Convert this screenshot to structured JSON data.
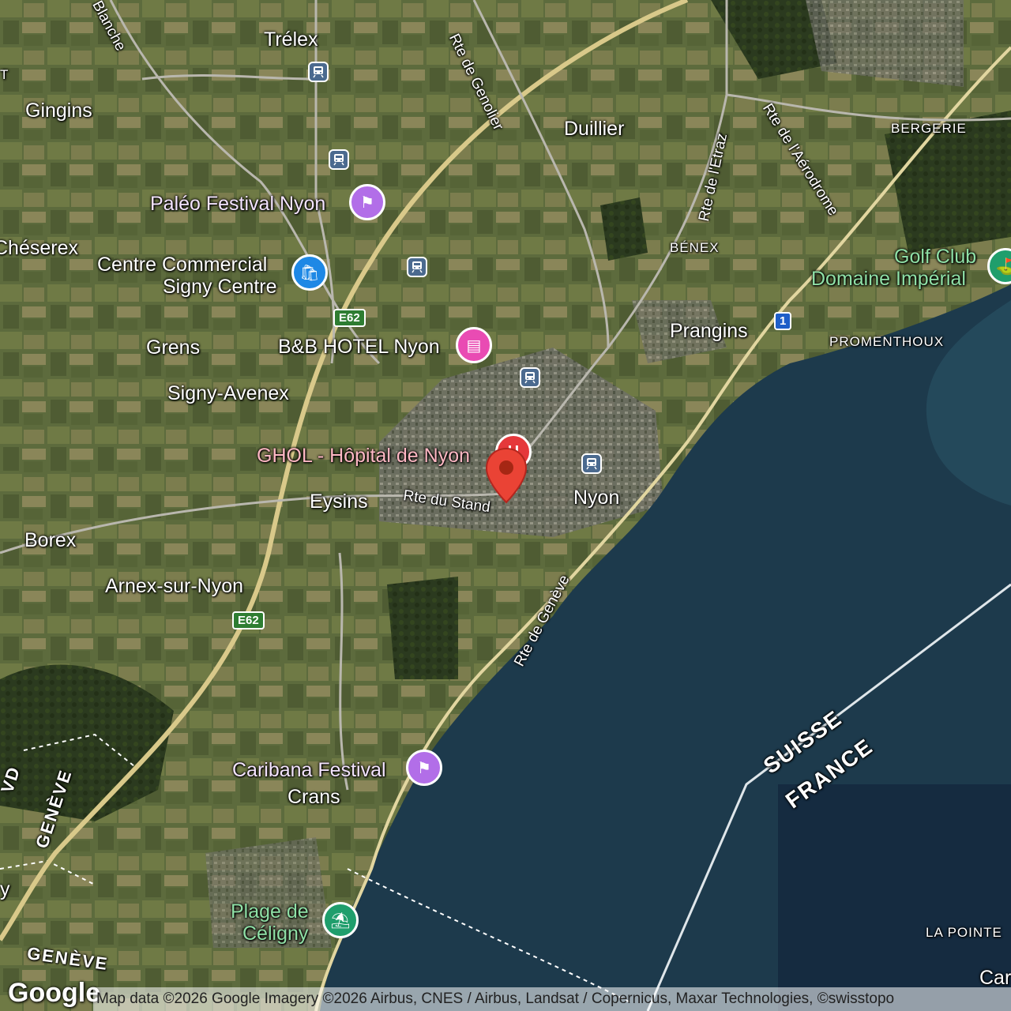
{
  "map": {
    "type": "satellite",
    "towns": [
      "Trélex",
      "Gingins",
      "Duillier",
      "Chéserex",
      "Grens",
      "Signy-Avenex",
      "Prangins",
      "Eysins",
      "Nyon",
      "Borex",
      "Arnex-sur-Nyon",
      "Crans"
    ],
    "hamlets": [
      "BERGERIE",
      "BÉNEX",
      "PROMENTHOUX",
      "LA POINTE"
    ],
    "roads": [
      "Rte de Genolier",
      "Rte de l'Etraz",
      "Rte de l'Aérodrome",
      "Rte du Stand",
      "Rte de Genève",
      "Blanche"
    ],
    "shields": [
      "E62",
      "E62",
      "1"
    ],
    "pois": {
      "paleo": "Paléo Festival Nyon",
      "signy_line1": "Centre Commercial",
      "signy_line2": "Signy Centre",
      "bb": "B&B HOTEL Nyon",
      "hospital": "GHOL - Hôpital de Nyon",
      "golf_line1": "Golf Club",
      "golf_line2": "Domaine Impérial",
      "caribana": "Caribana Festival",
      "plage_line1": "Plage de",
      "plage_line2": "Céligny"
    },
    "borders": [
      "SUISSE",
      "FRANCE",
      "GENÈVE",
      "GENÈVE",
      "VD"
    ],
    "edge_fragments": [
      "T",
      "y",
      "Car"
    ],
    "logo": "Google",
    "attribution": "Map data ©2026 Google Imagery ©2026 Airbus, CNES / Airbus, Landsat / Copernicus, Maxar Technologies, ©swisstopo",
    "colors": {
      "lake": "#1d3a4c",
      "fields": "#5d6b3d",
      "purple_poi": "#b26ee8",
      "blue_poi": "#1e88e5",
      "pink_poi": "#e94bb3",
      "red_poi": "#e5383b",
      "green_poi": "#1f9e6c",
      "marker": "#ea4335"
    }
  }
}
